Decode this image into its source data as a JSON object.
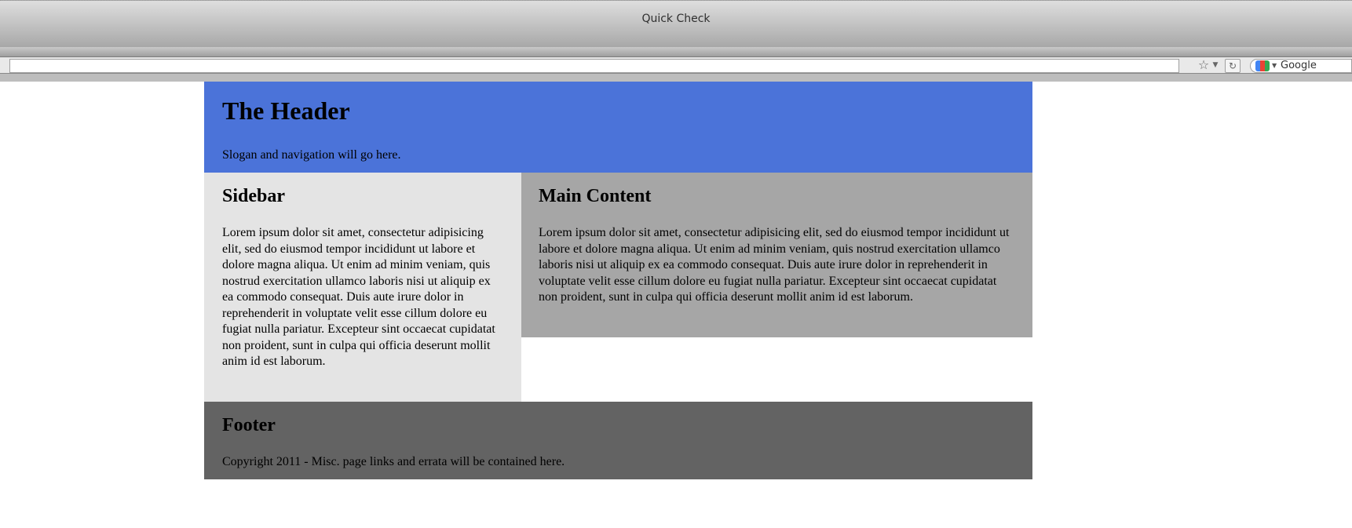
{
  "window": {
    "title": "Quick Check"
  },
  "toolbar": {
    "url_value": "",
    "search_engine_label": "Google",
    "icons": {
      "bookmark": "star-icon",
      "history_dropdown": "chevron-down-icon",
      "reload": "reload-icon",
      "search_engine": "google-logo-icon"
    }
  },
  "page": {
    "header": {
      "title": "The Header",
      "slogan": "Slogan and navigation will go here.",
      "background": "#4b73d9"
    },
    "sidebar": {
      "title": "Sidebar",
      "body": "Lorem ipsum dolor sit amet, consectetur adipisicing elit, sed do eiusmod tempor incididunt ut labore et dolore magna aliqua. Ut enim ad minim veniam, quis nostrud exercitation ullamco laboris nisi ut aliquip ex ea commodo consequat. Duis aute irure dolor in reprehenderit in voluptate velit esse cillum dolore eu fugiat nulla pariatur. Excepteur sint occaecat cupidatat non proident, sunt in culpa qui officia deserunt mollit anim id est laborum.",
      "background": "#e4e4e4"
    },
    "main": {
      "title": "Main Content",
      "body": "Lorem ipsum dolor sit amet, consectetur adipisicing elit, sed do eiusmod tempor incididunt ut labore et dolore magna aliqua. Ut enim ad minim veniam, quis nostrud exercitation ullamco laboris nisi ut aliquip ex ea commodo consequat. Duis aute irure dolor in reprehenderit in voluptate velit esse cillum dolore eu fugiat nulla pariatur. Excepteur sint occaecat cupidatat non proident, sunt in culpa qui officia deserunt mollit anim id est laborum.",
      "background": "#a6a6a6"
    },
    "footer": {
      "title": "Footer",
      "text": "Copyright 2011 - Misc. page links and errata will be contained here.",
      "background": "#636363"
    }
  }
}
